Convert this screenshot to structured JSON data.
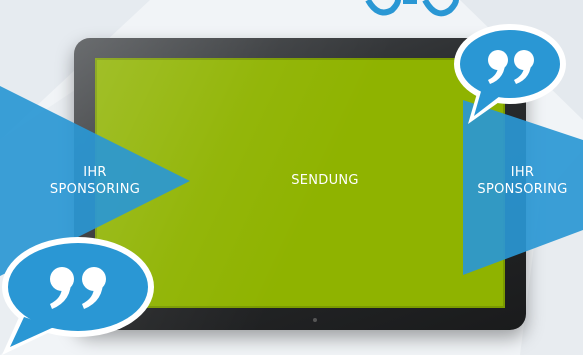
{
  "screen": {
    "center_label": "SENDUNG",
    "color": "#8fb300"
  },
  "left_block": {
    "line1": "IHR",
    "line2": "SPONSORING"
  },
  "right_block": {
    "line1": "IHR",
    "line2": "SPONSORING"
  },
  "colors": {
    "arrow": "#2a97d4",
    "bubble": "#2a97d4",
    "frame": "#2a2c2e",
    "background": "#f1f4f7"
  },
  "icons": {
    "quote_top": "quote-bubble-icon",
    "quote_bottom": "quote-bubble-icon"
  }
}
